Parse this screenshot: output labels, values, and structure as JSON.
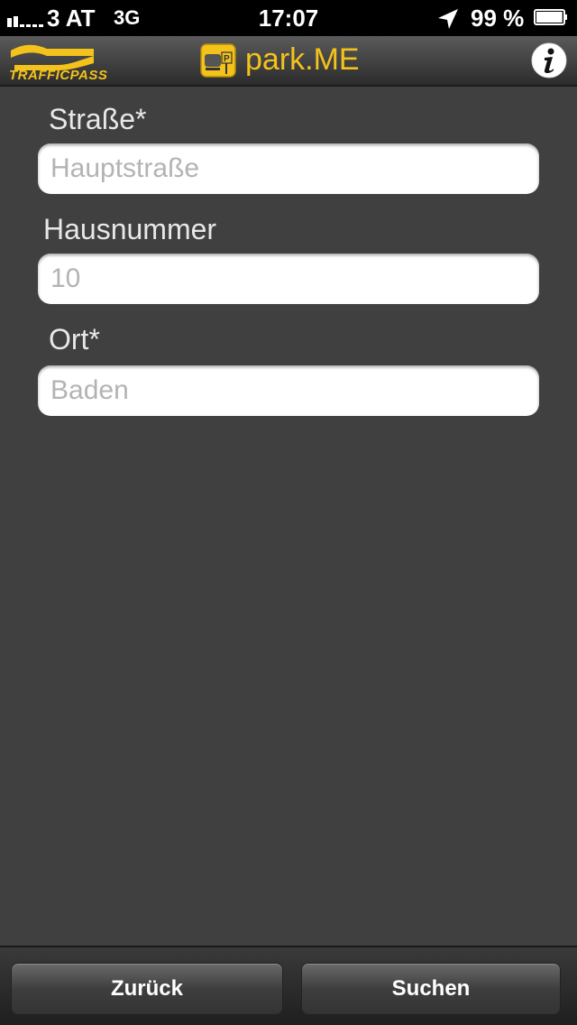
{
  "status_bar": {
    "carrier": "3 AT",
    "network": "3G",
    "time": "17:07",
    "battery_percent": "99 %",
    "battery_level": 0.99
  },
  "header": {
    "logo_text": "TRAFFICPASS",
    "app_name": "park.ME",
    "app_icon_text": "park.ME",
    "accent_color": "#f3c21b"
  },
  "form": {
    "fields": [
      {
        "label": "Straße*",
        "placeholder": "Hauptstraße",
        "value": ""
      },
      {
        "label": "Hausnummer",
        "placeholder": "10",
        "value": ""
      },
      {
        "label": "Ort*",
        "placeholder": "Baden",
        "value": ""
      }
    ]
  },
  "toolbar": {
    "back_label": "Zurück",
    "search_label": "Suchen"
  }
}
